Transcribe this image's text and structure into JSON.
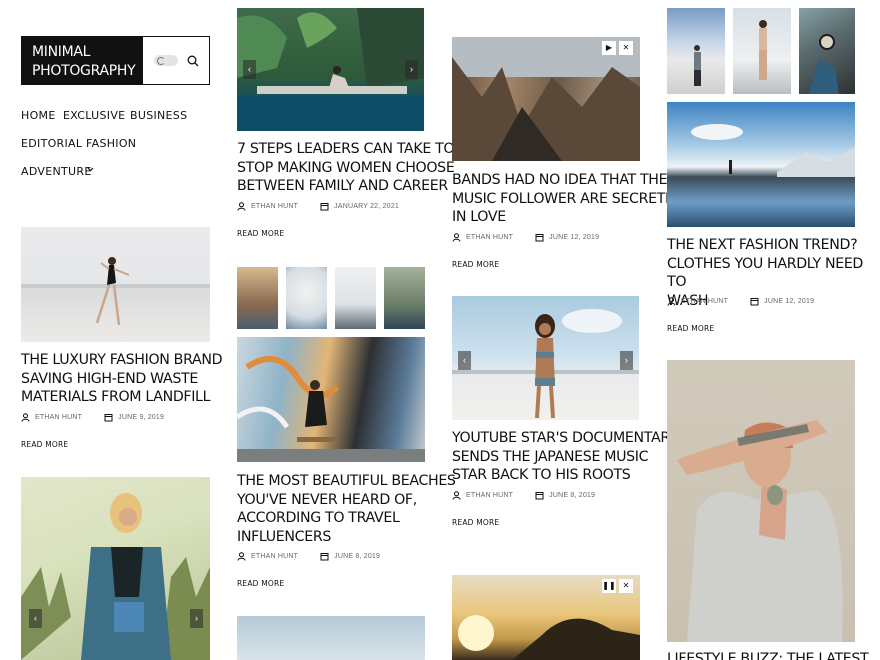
{
  "brand": {
    "line1": "MINIMAL",
    "line2": "PHOTOGRAPHY"
  },
  "nav": {
    "home": "HOME",
    "exclusive": "EXCLUSIVE",
    "business": "BUSINESS",
    "editorial": "EDITORIAL",
    "fashion": "FASHION",
    "adventure": "ADVENTURE"
  },
  "posts": {
    "luxury": {
      "title_lines": [
        "THE LUXURY FASHION BRAND",
        "SAVING HIGH-END WASTE",
        "MATERIALS FROM LANDFILL"
      ],
      "author": "ETHAN HUNT",
      "date": "JUNE 9, 2019",
      "read": "READ MORE"
    },
    "leaders": {
      "title_lines": [
        "7 STEPS LEADERS CAN TAKE TO",
        "STOP MAKING WOMEN CHOOSE",
        "BETWEEN FAMILY AND CAREER"
      ],
      "author": "ETHAN HUNT",
      "date": "JANUARY 22, 2021",
      "read": "READ MORE"
    },
    "beaches": {
      "title_lines": [
        "THE MOST BEAUTIFUL BEACHES",
        "YOU'VE NEVER HEARD OF,",
        "ACCORDING TO TRAVEL",
        "INFLUENCERS"
      ],
      "author": "ETHAN HUNT",
      "date": "JUNE 8, 2019",
      "read": "READ MORE"
    },
    "bands": {
      "title_lines": [
        "BANDS HAD NO IDEA THAT THEIR",
        "MUSIC FOLLOWER ARE SECRETLY",
        "IN LOVE"
      ],
      "author": "ETHAN HUNT",
      "date": "JUNE 12, 2019",
      "read": "READ MORE"
    },
    "youtube": {
      "title_lines": [
        "YOUTUBE STAR'S DOCUMENTARY",
        "SENDS THE JAPANESE MUSIC",
        "STAR BACK TO HIS ROOTS"
      ],
      "author": "ETHAN HUNT",
      "date": "JUNE 8, 2019",
      "read": "READ MORE"
    },
    "trend": {
      "title_lines": [
        "THE NEXT FASHION TREND?",
        "CLOTHES YOU HARDLY NEED TO",
        "WASH"
      ],
      "author": "ETHAN HUNT",
      "date": "JUNE 12, 2019",
      "read": "READ MORE"
    },
    "lifestyle": {
      "title_lines": [
        "LIFESTYLE BUZZ: THE LATEST IN"
      ]
    }
  },
  "icons": {
    "search": "search-icon",
    "dark_mode": "moon-icon",
    "dropdown": "chevron-down-icon",
    "author": "user-icon",
    "date": "calendar-icon",
    "prev": "chevron-left-icon",
    "next": "chevron-right-icon",
    "play": "play-icon",
    "pause": "pause-icon",
    "mute": "mute-icon"
  },
  "colors": {
    "text": "#111111",
    "meta": "#666666",
    "background": "#ffffff",
    "brand_bg": "#111111"
  }
}
